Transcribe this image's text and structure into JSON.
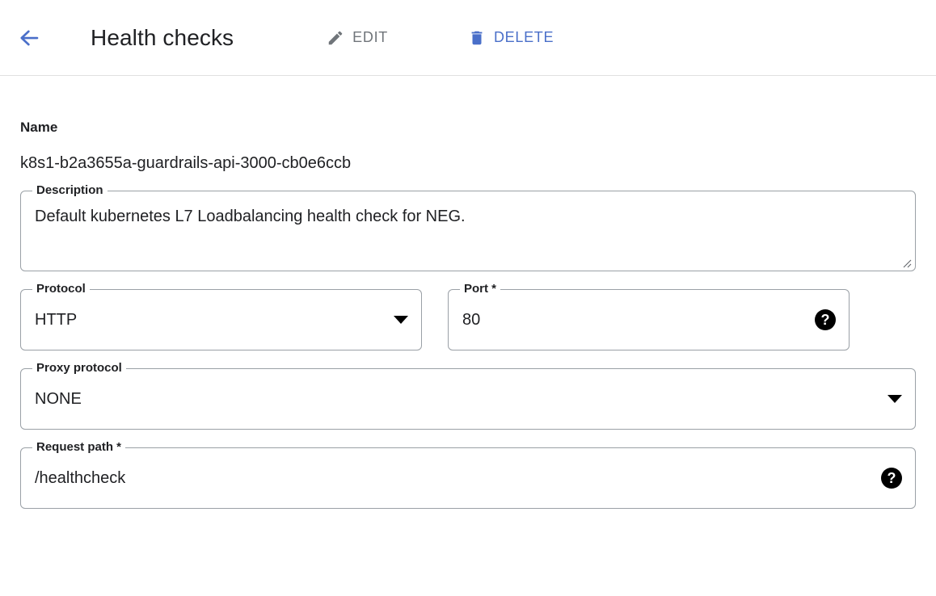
{
  "header": {
    "back_icon": "arrow-left-icon",
    "title": "Health checks",
    "edit": {
      "label": "EDIT",
      "icon": "pencil-icon",
      "enabled": false,
      "color": "#70757a"
    },
    "delete": {
      "label": "DELETE",
      "icon": "trash-icon",
      "enabled": true,
      "color": "#4a6fc9"
    }
  },
  "colors": {
    "accent_blue": "#4a6fc9",
    "disabled_gray": "#70757a",
    "border_gray": "#9aa0a6",
    "divider": "#e0e0e0",
    "text": "#202124"
  },
  "details": {
    "name": {
      "label": "Name",
      "value": "k8s1-b2a3655a-guardrails-api-3000-cb0e6ccb"
    },
    "description": {
      "label": "Description",
      "value": "Default kubernetes L7 Loadbalancing health check for NEG.",
      "resize_handle": "resize-grip-icon"
    },
    "protocol": {
      "label": "Protocol",
      "value": "HTTP",
      "dropdown_icon": "chevron-down-icon"
    },
    "port": {
      "label": "Port *",
      "value": "80",
      "help_icon": "help-icon",
      "help_glyph": "?"
    },
    "proxy_protocol": {
      "label": "Proxy protocol",
      "value": "NONE",
      "dropdown_icon": "chevron-down-icon"
    },
    "request_path": {
      "label": "Request path *",
      "value": "/healthcheck",
      "help_icon": "help-icon",
      "help_glyph": "?"
    }
  }
}
